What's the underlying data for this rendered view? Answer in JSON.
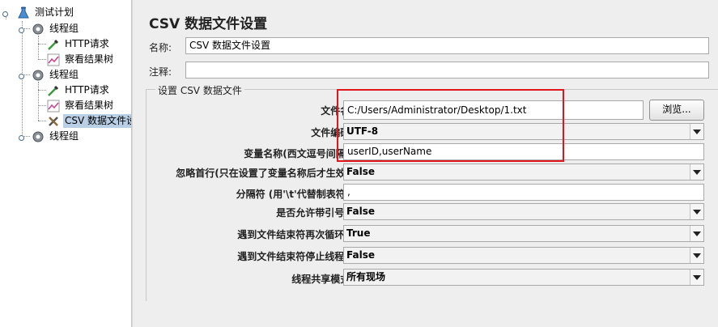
{
  "tree": {
    "items": [
      {
        "label": "测试计划",
        "icon": "flask-icon",
        "level": 0
      },
      {
        "label": "线程组",
        "icon": "gear-icon",
        "level": 1
      },
      {
        "label": "HTTP请求",
        "icon": "pipette-icon",
        "level": 2
      },
      {
        "label": "察看结果树",
        "icon": "chart-icon",
        "level": 2
      },
      {
        "label": "线程组",
        "icon": "gear-icon",
        "level": 1
      },
      {
        "label": "HTTP请求",
        "icon": "pipette-icon",
        "level": 2
      },
      {
        "label": "察看结果树",
        "icon": "chart-icon",
        "level": 2
      },
      {
        "label": "CSV 数据文件设",
        "icon": "tools-icon",
        "level": 2,
        "selected": true
      },
      {
        "label": "线程组",
        "icon": "gear-icon",
        "level": 1
      }
    ]
  },
  "panel": {
    "title": "CSV 数据文件设置",
    "name_label": "名称:",
    "name_value": "CSV 数据文件设置",
    "comment_label": "注释:",
    "comment_value": "",
    "group_title": "设置 CSV 数据文件",
    "browse_label": "浏览...",
    "fields": {
      "filename": {
        "label": "文件名:",
        "value": "C:/Users/Administrator/Desktop/1.txt"
      },
      "encoding": {
        "label": "文件编码:",
        "value": "UTF-8"
      },
      "varnames": {
        "label": "变量名称(西文逗号间隔):",
        "value": "userID,userName"
      },
      "ignore_first": {
        "label": "忽略首行(只在设置了变量名称后才生效):",
        "value": "False"
      },
      "delimiter": {
        "label": "分隔符 (用'\\t'代替制表符):",
        "value": ","
      },
      "allow_quoted": {
        "label": "是否允许带引号?:",
        "value": "False"
      },
      "recycle_eof": {
        "label": "遇到文件结束符再次循环?:",
        "value": "True"
      },
      "stop_eof": {
        "label": "遇到文件结束符停止线程?:",
        "value": "False"
      },
      "sharing": {
        "label": "线程共享模式:",
        "value": "所有现场"
      }
    }
  },
  "colors": {
    "highlight": "#e0161c",
    "selection": "#b8cfe5"
  }
}
